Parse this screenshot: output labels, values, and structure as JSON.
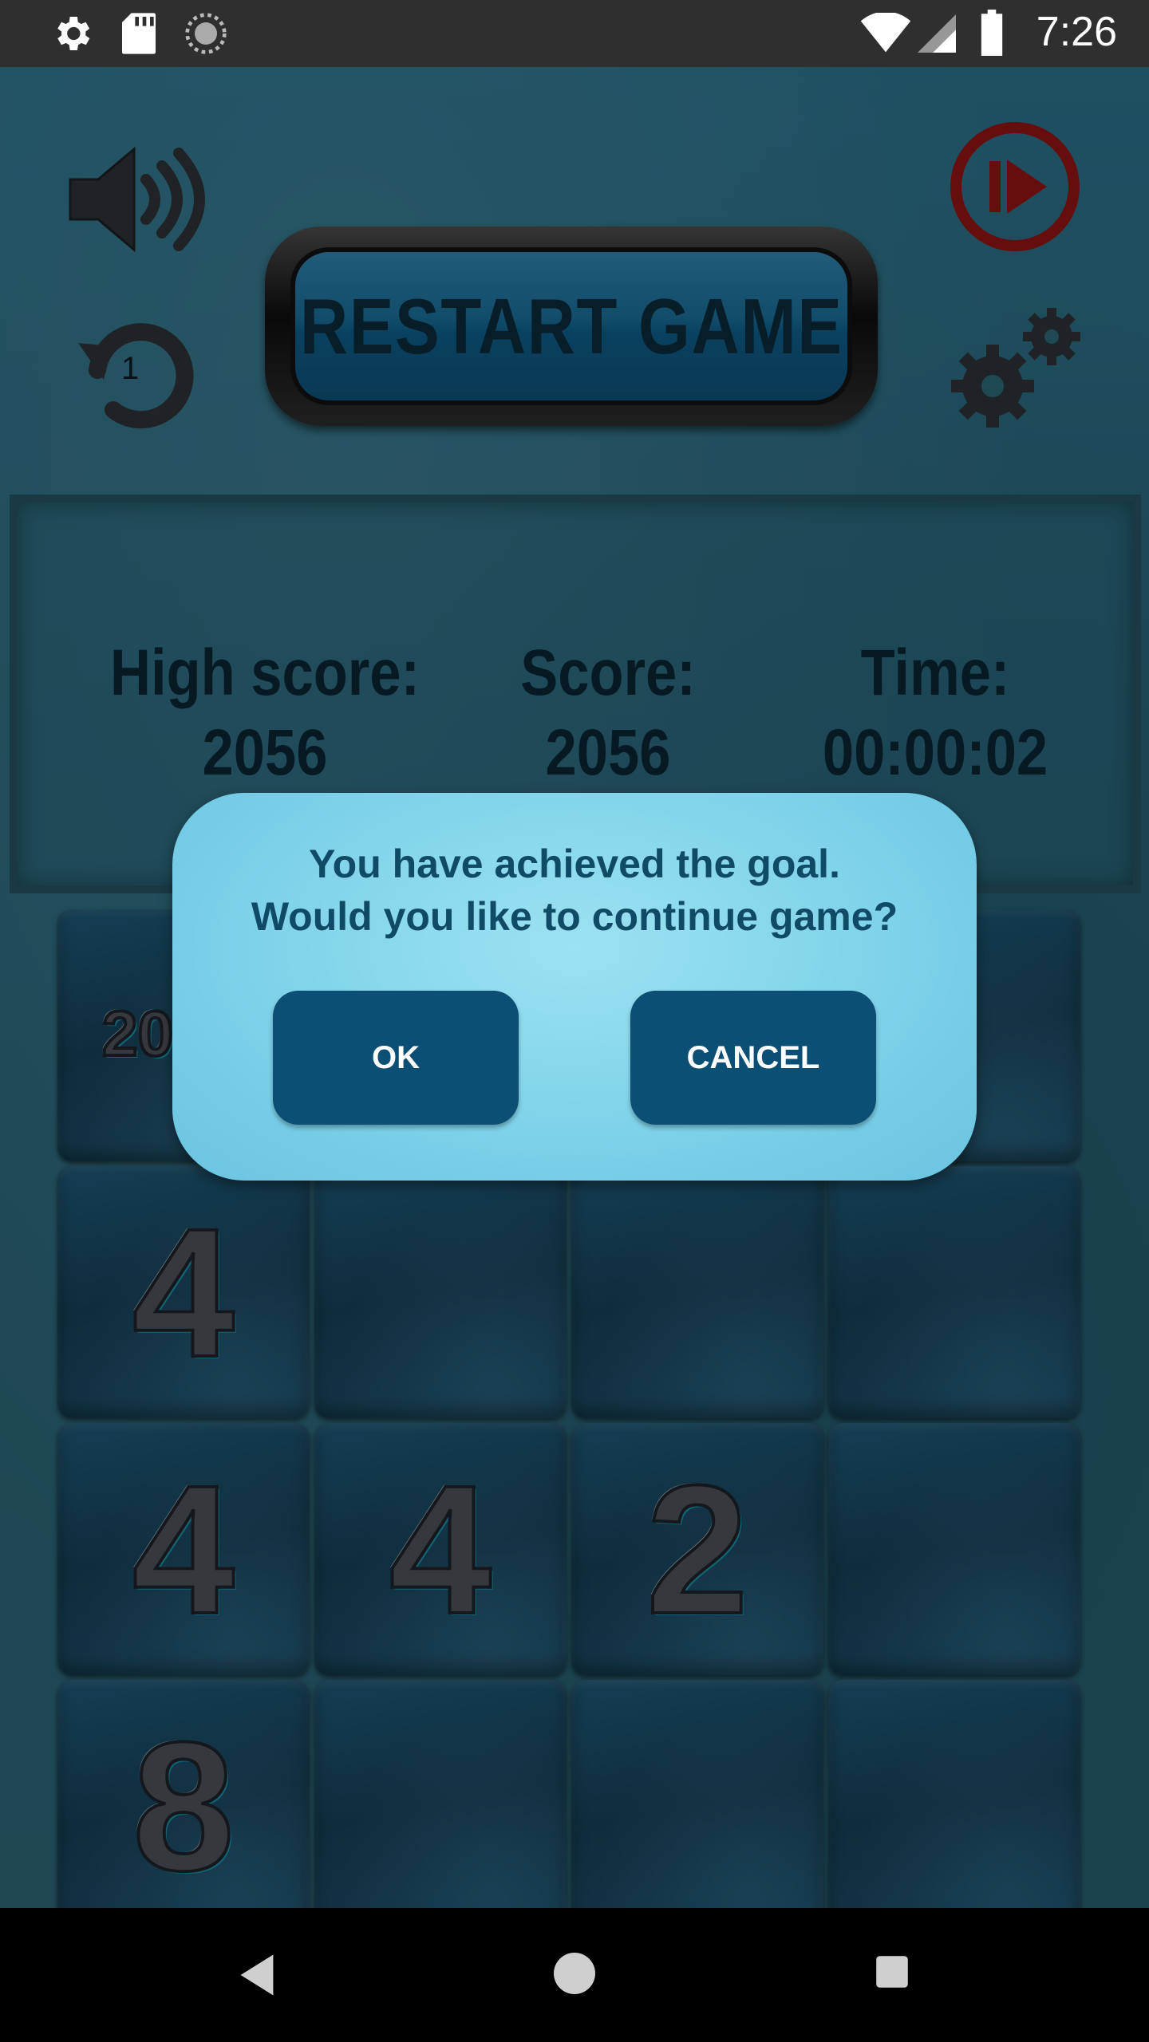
{
  "status_bar": {
    "time": "7:26",
    "icons": [
      "gear-icon",
      "sd-card-icon",
      "loading-icon",
      "wifi-icon",
      "signal-icon",
      "battery-icon"
    ]
  },
  "toolbar": {
    "sound_icon": "speaker-icon",
    "play_icon": "play-icon",
    "undo_icon": "undo-icon",
    "undo_count": "1",
    "settings_icon": "gears-icon",
    "restart_label": "RESTART GAME"
  },
  "stats": {
    "high_score_label": "High score:",
    "high_score_value": "2056",
    "score_label": "Score:",
    "score_value": "2056",
    "time_label": "Time:",
    "time_value": "00:00:02"
  },
  "board": {
    "rows": [
      [
        "20",
        "",
        "",
        ""
      ],
      [
        "4",
        "",
        "",
        ""
      ],
      [
        "4",
        "4",
        "2",
        ""
      ],
      [
        "8",
        "",
        "",
        ""
      ]
    ]
  },
  "dialog": {
    "line1": "You have achieved the goal.",
    "line2": "Would you like to continue game?",
    "ok_label": "OK",
    "cancel_label": "CANCEL"
  },
  "nav": {
    "back_icon": "back-icon",
    "home_icon": "home-icon",
    "recents_icon": "recents-icon"
  }
}
